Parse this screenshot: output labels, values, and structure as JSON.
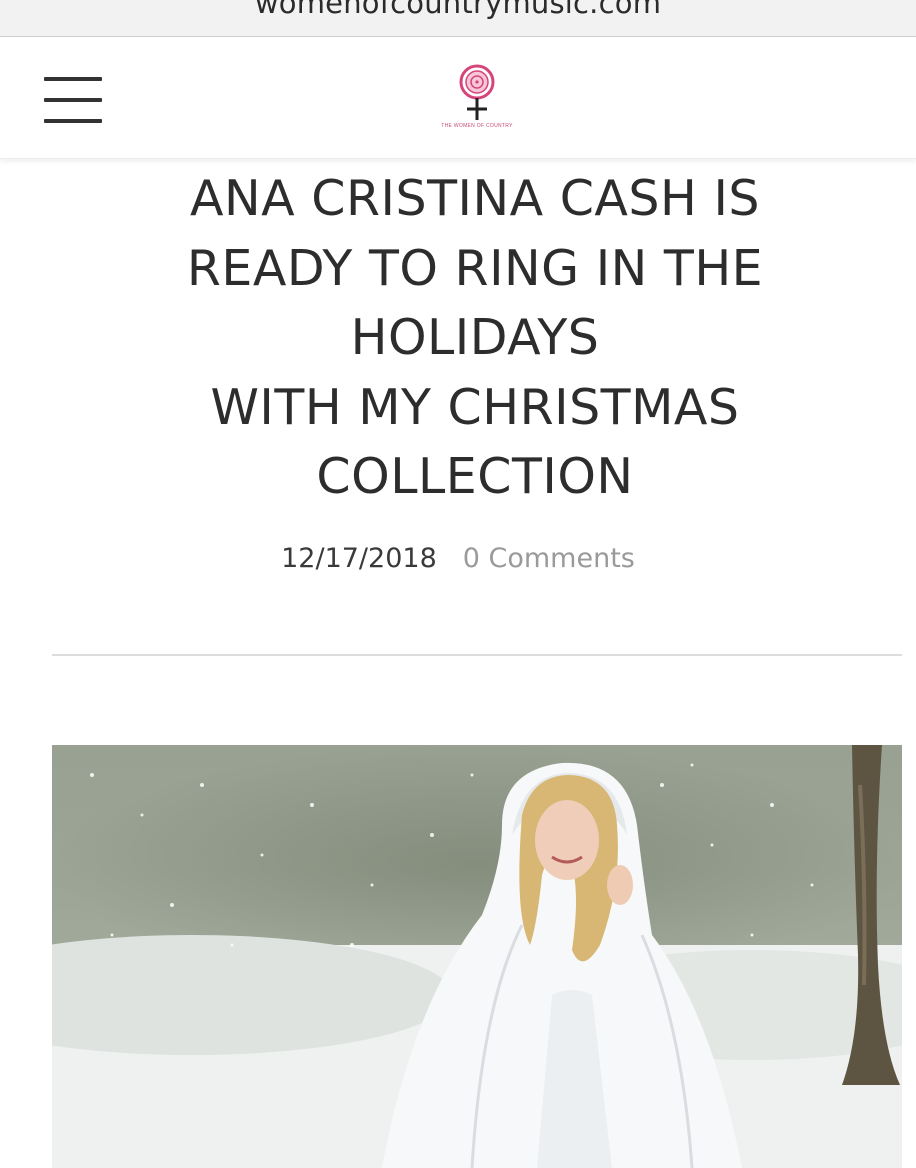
{
  "browser": {
    "url": "womenofcountrymusic.com"
  },
  "header": {
    "menu_icon": "hamburger-icon",
    "logo_icon": "women-of-country-logo",
    "logo_text": "THE WOMEN OF COUNTRY"
  },
  "article": {
    "title": "ANA CRISTINA CASH IS\nREADY TO RING IN THE\nHOLIDAYS\nWITH MY CHRISTMAS\nCOLLECTION",
    "date": "12/17/2018",
    "comments": "0 Comments"
  },
  "colors": {
    "logo_pink": "#d6457a",
    "title_text": "#2d2d2d",
    "comments_text": "#9a9a9a"
  }
}
